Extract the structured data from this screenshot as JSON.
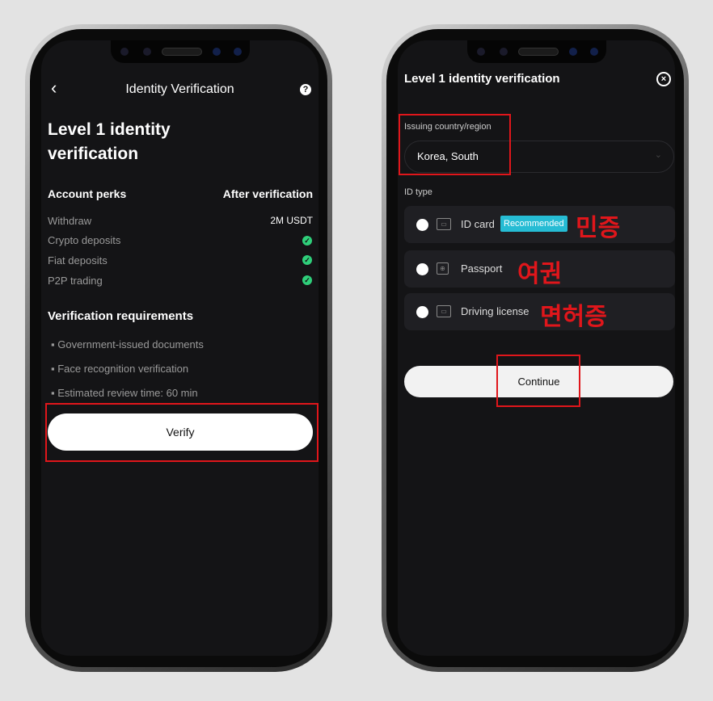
{
  "left": {
    "header": {
      "title": "Identity Verification",
      "back_icon": "chevron-left-icon",
      "help_icon": "question-circle-icon"
    },
    "heading_line1": "Level 1 identity",
    "heading_line2": "verification",
    "perks": {
      "col1": "Account perks",
      "col2": "After verification",
      "rows": [
        {
          "label": "Withdraw",
          "value": "2M USDT"
        },
        {
          "label": "Crypto deposits",
          "value": "✓"
        },
        {
          "label": "Fiat deposits",
          "value": "✓"
        },
        {
          "label": "P2P trading",
          "value": "✓"
        }
      ]
    },
    "requirements": {
      "title": "Verification requirements",
      "items": [
        "Government-issued documents",
        "Face recognition verification",
        "Estimated review time: 60 min"
      ]
    },
    "verify_label": "Verify"
  },
  "right": {
    "title": "Level 1 identity verification",
    "close_icon": "close-circle-icon",
    "country_label": "Issuing country/region",
    "country_value": "Korea, South",
    "id_type_label": "ID type",
    "options": [
      {
        "label": "ID card",
        "badge": "Recommended",
        "annotation": "민증",
        "icon": "id-card-icon"
      },
      {
        "label": "Passport",
        "annotation": "여권",
        "icon": "passport-icon"
      },
      {
        "label": "Driving license",
        "annotation": "면허증",
        "icon": "driving-license-icon"
      }
    ],
    "continue_label": "Continue"
  },
  "colors": {
    "accent_badge": "#26bcd4",
    "check": "#2fcf7a",
    "annotation_red": "#e0161b"
  }
}
